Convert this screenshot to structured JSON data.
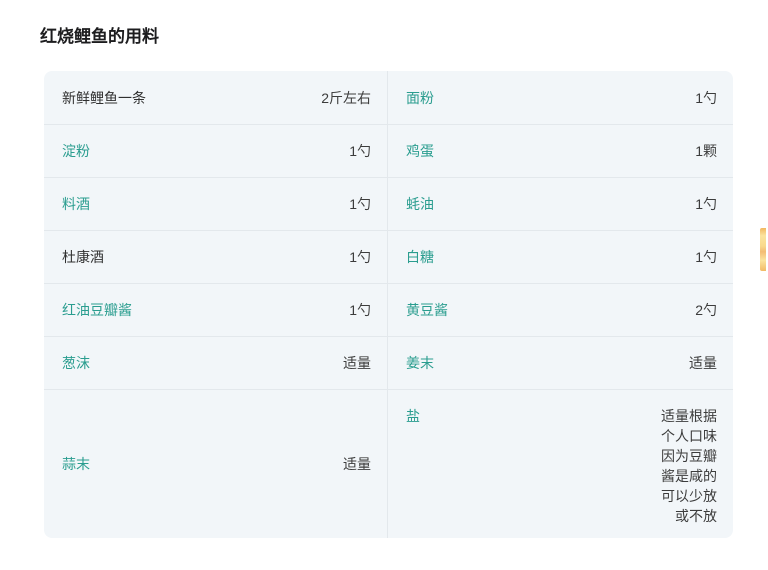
{
  "page_title": "红烧鲤鱼的用料",
  "table": {
    "left": [
      {
        "name": "新鲜鲤鱼一条",
        "amount": "2斤左右",
        "link": false
      },
      {
        "name": "淀粉",
        "amount": "1勺",
        "link": true
      },
      {
        "name": "料酒",
        "amount": "1勺",
        "link": true
      },
      {
        "name": "杜康酒",
        "amount": "1勺",
        "link": false
      },
      {
        "name": "红油豆瓣酱",
        "amount": "1勺",
        "link": true
      },
      {
        "name": "葱沫",
        "amount": "适量",
        "link": true
      },
      {
        "name": "蒜末",
        "amount": "适量",
        "link": true
      }
    ],
    "right": [
      {
        "name": "面粉",
        "amount": "1勺",
        "link": true
      },
      {
        "name": "鸡蛋",
        "amount": "1颗",
        "link": true
      },
      {
        "name": "蚝油",
        "amount": "1勺",
        "link": true
      },
      {
        "name": "白糖",
        "amount": "1勺",
        "link": true
      },
      {
        "name": "黄豆酱",
        "amount": "2勺",
        "link": true
      },
      {
        "name": "姜末",
        "amount": "适量",
        "link": true
      },
      {
        "name": "盐",
        "amount": "适量根据个人口味因为豆瓣酱是咸的可以少放或不放",
        "link": true
      }
    ]
  },
  "colors": {
    "link_text": "#2a9d8f",
    "cell_background": "#f2f6f9",
    "cell_border": "#e3e8ec",
    "title_text": "#1d1d1f",
    "widget_yellow": "#fbe49e"
  }
}
